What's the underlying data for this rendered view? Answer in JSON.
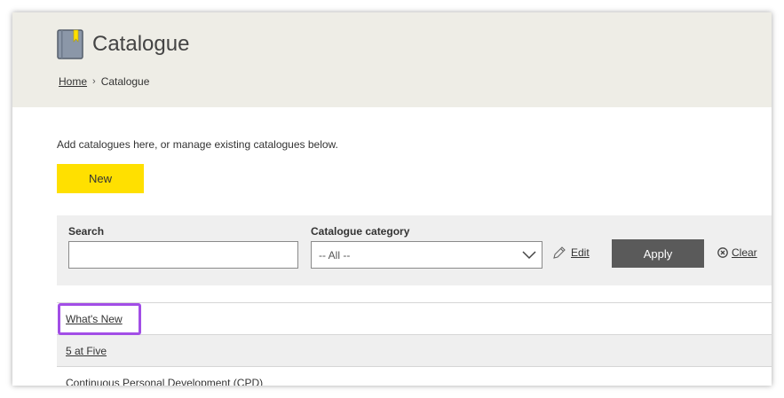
{
  "header": {
    "title": "Catalogue",
    "breadcrumb": {
      "home": "Home",
      "separator": "›",
      "current": "Catalogue"
    }
  },
  "main": {
    "intro": "Add catalogues here, or manage existing catalogues below.",
    "new_label": "New"
  },
  "filter": {
    "search_label": "Search",
    "search_value": "",
    "category_label": "Catalogue category",
    "category_selected": "-- All --",
    "edit_label": "Edit",
    "apply_label": "Apply",
    "clear_label": "Clear"
  },
  "list": {
    "items": [
      "What's New",
      "5 at Five",
      "Continuous Personal Development (CPD)"
    ]
  },
  "colors": {
    "new_button": "#ffe000",
    "apply_button": "#5a5a5a",
    "highlight": "#a24ee6",
    "header_bg": "#eeede6"
  },
  "icons": [
    "book-icon",
    "chevron-right-icon",
    "chevron-down-icon",
    "pencil-icon",
    "close-circle-icon"
  ]
}
